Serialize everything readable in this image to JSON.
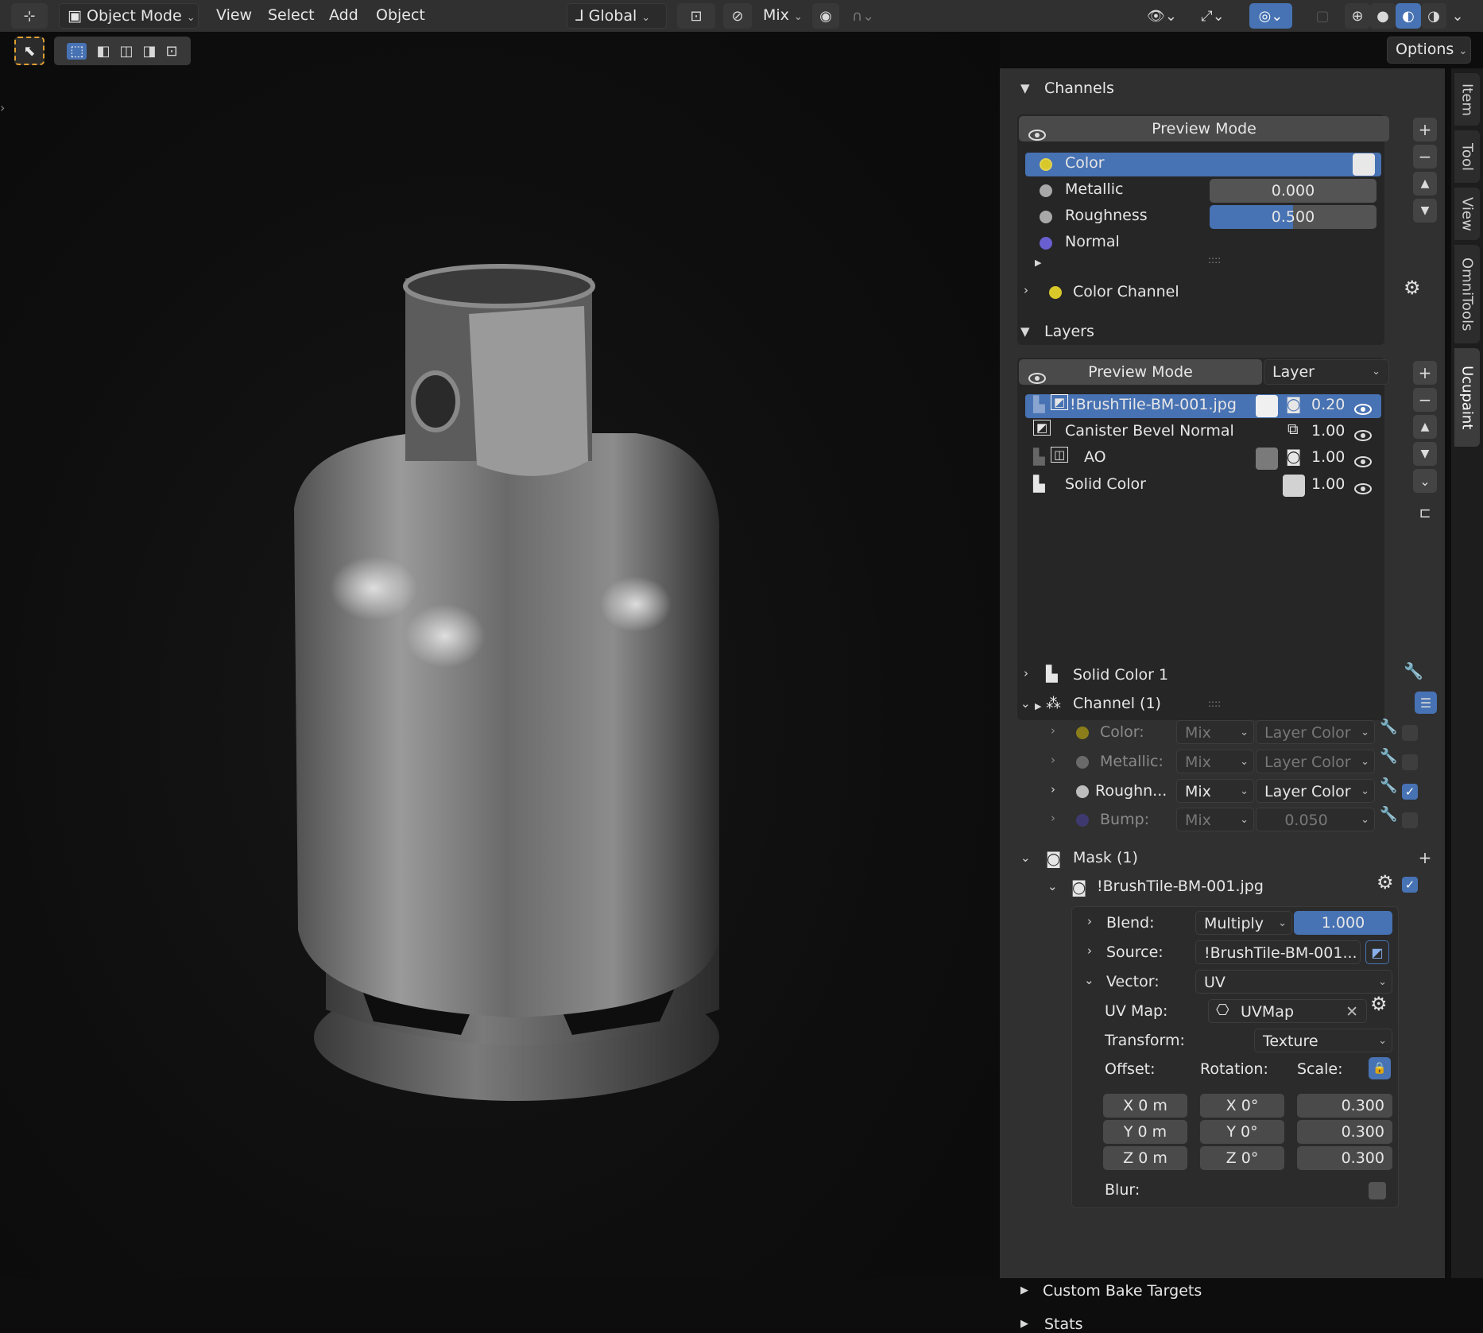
{
  "header": {
    "mode": "Object Mode",
    "menus": [
      "View",
      "Select",
      "Add",
      "Object"
    ],
    "orientation": "Global",
    "blend": "Mix"
  },
  "options_label": "Options",
  "tabs": [
    "Item",
    "Tool",
    "View",
    "OmniTools",
    "Ucupaint"
  ],
  "channels": {
    "title": "Channels",
    "preview": "Preview Mode",
    "items": [
      {
        "name": "Color",
        "value": "",
        "color": "#d9c82a"
      },
      {
        "name": "Metallic",
        "value": "0.000",
        "color": "#a8a8a8"
      },
      {
        "name": "Roughness",
        "value": "0.500",
        "color": "#a8a8a8"
      },
      {
        "name": "Normal",
        "value": "",
        "color": "#6a5fd0"
      }
    ],
    "sub": "Color Channel",
    "handle": "::::"
  },
  "layers": {
    "title": "Layers",
    "preview": "Preview Mode",
    "type": "Layer",
    "items": [
      {
        "name": "!BrushTile-BM-001.jpg",
        "value": "0.20"
      },
      {
        "name": "Canister Bevel Normal",
        "value": "1.00"
      },
      {
        "name": "AO",
        "value": "1.00"
      },
      {
        "name": "Solid Color",
        "value": "1.00"
      }
    ]
  },
  "solid_color": "Solid Color 1",
  "channel_group": {
    "title": "Channel (1)",
    "rows": [
      {
        "name": "Color:",
        "blend": "Mix",
        "src": "Layer Color",
        "dim": true
      },
      {
        "name": "Metallic:",
        "blend": "Mix",
        "src": "Layer Color",
        "dim": true
      },
      {
        "name": "Roughn...",
        "blend": "Mix",
        "src": "Layer Color",
        "dim": false
      },
      {
        "name": "Bump:",
        "blend": "Mix",
        "src": "0.050",
        "dim": true
      }
    ]
  },
  "mask": {
    "title": "Mask (1)",
    "item": "!BrushTile-BM-001.jpg",
    "blend_label": "Blend:",
    "blend": "Multiply",
    "blend_value": "1.000",
    "source_label": "Source:",
    "source": "!BrushTile-BM-001...",
    "vector_label": "Vector:",
    "vector": "UV",
    "uvmap_label": "UV Map:",
    "uvmap": "UVMap",
    "transform_label": "Transform:",
    "transform": "Texture",
    "offset_label": "Offset:",
    "rotation_label": "Rotation:",
    "scale_label": "Scale:",
    "offset": [
      "X  0 m",
      "Y  0 m",
      "Z  0 m"
    ],
    "rotation": [
      "X    0°",
      "Y    0°",
      "Z    0°"
    ],
    "scale": [
      "0.300",
      "0.300",
      "0.300"
    ],
    "blur_label": "Blur:"
  },
  "bake": "Custom Bake Targets",
  "stats": "Stats"
}
